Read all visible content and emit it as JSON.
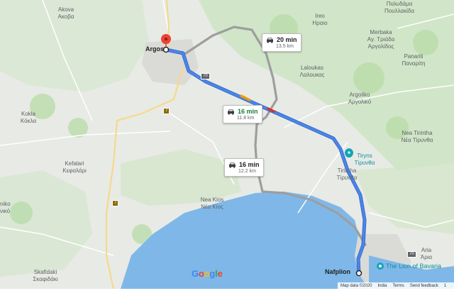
{
  "colors": {
    "land": "#e8eae5",
    "green": "#cfe6c4",
    "water": "#7fb8e8",
    "route_primary": "#4a86e8",
    "route_alt": "#9e9e9e",
    "road_yellow": "#f6d98c",
    "pin_red": "#ea4335"
  },
  "places": [
    {
      "id": "akova",
      "line1": "Akova",
      "line2": "Ακοβα"
    },
    {
      "id": "ireo",
      "line1": "Ireo",
      "line2": "Ηραιο"
    },
    {
      "id": "pyrgos",
      "line1": "Πολυδάμα",
      "line2": "Πουλλακίδα"
    },
    {
      "id": "merbaka",
      "line1": "Merbaka",
      "line2": "Αγ. Τριάδα",
      "line3": "Αργολίδος"
    },
    {
      "id": "panariti",
      "line1": "Panariti",
      "line2": "Παναρίτη"
    },
    {
      "id": "laloukas",
      "line1": "Laloukas",
      "line2": "Λαλουκας"
    },
    {
      "id": "argoliko",
      "line1": "Argoliko",
      "line2": "Αργολικό"
    },
    {
      "id": "kokla",
      "line1": "Kokla",
      "line2": "Κόκλα"
    },
    {
      "id": "kefalari",
      "line1": "Kefalari",
      "line2": "Κεφαλάρι"
    },
    {
      "id": "nea_tirintha",
      "line1": "Nea Tirintha",
      "line2": "Νέα Τίρυνθα"
    },
    {
      "id": "tirintha",
      "line1": "Tirintha",
      "line2": "Τίρυνθα"
    },
    {
      "id": "nea_kios",
      "line1": "Nea Kios",
      "line2": "Νέα Κίος"
    },
    {
      "id": "ria",
      "line1": "Aria",
      "line2": "Άρια"
    },
    {
      "id": "skafidaki",
      "line1": "Skafidaki",
      "line2": "Σκαφιδάκι"
    },
    {
      "id": "niko",
      "line1": "niko",
      "line2": "νικό"
    }
  ],
  "cities": {
    "argos": "Argos",
    "nafplion": "Nafplion"
  },
  "pois": {
    "tiryns_line1": "Tiryns",
    "tiryns_line2": "Τίρυνθα",
    "lion": "The Lion of Bavaria"
  },
  "routes": [
    {
      "id": "route-top",
      "time": "20 min",
      "distance": "13.5 km",
      "selected": false
    },
    {
      "id": "route-main",
      "time": "16 min",
      "distance": "11.8 km",
      "selected": true
    },
    {
      "id": "route-coast",
      "time": "16 min",
      "distance": "12.2 km",
      "selected": false
    }
  ],
  "shields": {
    "r70": "70",
    "r7": "7"
  },
  "footer": {
    "map_data": "Map data ©2020",
    "country": "India",
    "terms": "Terms",
    "feedback": "Send feedback",
    "scale": "1"
  },
  "logo": "Google"
}
